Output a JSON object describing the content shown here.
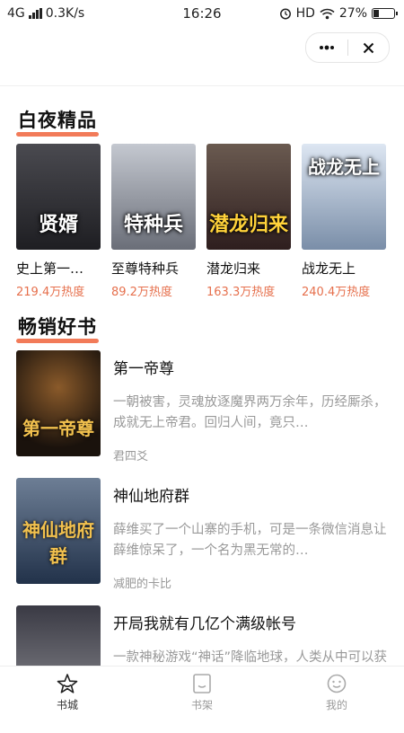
{
  "status_bar": {
    "network": "4G",
    "speed": "0.3K/s",
    "time": "16:26",
    "hd": "HD",
    "battery": "27%",
    "battery_level": 0.27
  },
  "capsule": {
    "more_icon": "more-dots-icon",
    "close_icon": "close-icon"
  },
  "section_featured": {
    "title": "白夜精品"
  },
  "featured_books": [
    {
      "title": "史上第一…",
      "heat": "219.4万热度",
      "cover_text": "贤婿",
      "cover_color": "#2a2a2a"
    },
    {
      "title": "至尊特种兵",
      "heat": "89.2万热度",
      "cover_text": "特种兵",
      "cover_color": "#8a8f99"
    },
    {
      "title": "潜龙归来",
      "heat": "163.3万热度",
      "cover_text": "潜龙归来",
      "cover_color": "#5a3a3a"
    },
    {
      "title": "战龙无上",
      "heat": "240.4万热度",
      "cover_text": "战龙无上",
      "cover_color": "#8fa8c8"
    }
  ],
  "section_bestsellers": {
    "title": "畅销好书"
  },
  "bestsellers": [
    {
      "title": "第一帝尊",
      "desc": "一朝被害，灵魂放逐魔界两万余年，历经厮杀，成就无上帝君。回归人间，竟只…",
      "author": "君四爻",
      "cover_text": "第一帝尊",
      "cover_color": "#3a2a1e"
    },
    {
      "title": "神仙地府群",
      "desc": "薛维买了一个山寨的手机，可是一条微信消息让薛维惊呆了，一个名为黑无常的…",
      "author": "减肥的卡比",
      "cover_text": "神仙地府群",
      "cover_color": "#2f3f55"
    },
    {
      "title": "开局我就有几亿个满级帐号",
      "desc": "一款神秘游戏“神话”降临地球，人类从中可以获得各种功法和能力，各种天地…",
      "author": "",
      "cover_text": "",
      "cover_color": "#4a4a52"
    }
  ],
  "tabbar": [
    {
      "label": "书城",
      "icon": "bookstore-star-icon",
      "active": true
    },
    {
      "label": "书架",
      "icon": "bookshelf-icon",
      "active": false
    },
    {
      "label": "我的",
      "icon": "profile-face-icon",
      "active": false
    }
  ],
  "colors": {
    "accent": "#f0643c",
    "heat": "#e6704d",
    "muted": "#999999"
  }
}
